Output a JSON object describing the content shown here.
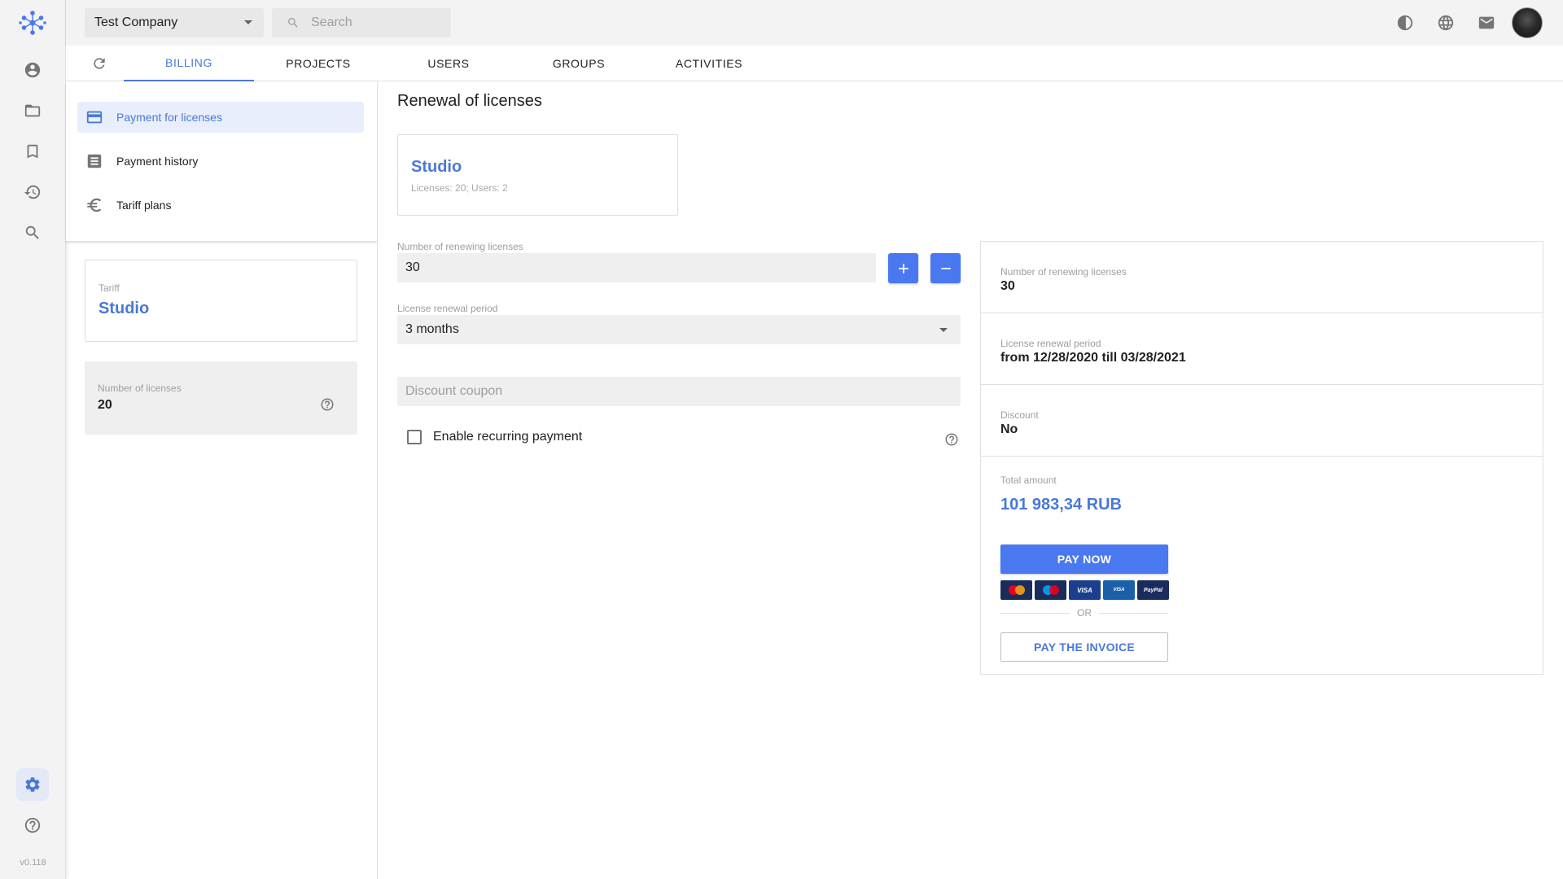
{
  "app": {
    "version": "v0.118"
  },
  "topbar": {
    "company": "Test Company",
    "search_placeholder": "Search"
  },
  "tabs": [
    {
      "label": "BILLING",
      "active": true
    },
    {
      "label": "PROJECTS",
      "active": false
    },
    {
      "label": "USERS",
      "active": false
    },
    {
      "label": "GROUPS",
      "active": false
    },
    {
      "label": "ACTIVITIES",
      "active": false
    }
  ],
  "menu": {
    "items": [
      {
        "label": "Payment for licenses",
        "icon": "credit-card-icon",
        "active": true
      },
      {
        "label": "Payment history",
        "icon": "receipt-list-icon",
        "active": false
      },
      {
        "label": "Tariff plans",
        "icon": "euro-icon",
        "active": false
      }
    ]
  },
  "tariff": {
    "label": "Tariff",
    "name": "Studio"
  },
  "licenses": {
    "label": "Number of licenses",
    "value": "20"
  },
  "main": {
    "title": "Renewal of licenses",
    "plan": {
      "name": "Studio",
      "meta": "Licenses: 20; Users: 2"
    },
    "renewing_label": "Number of renewing licenses",
    "renewing_value": "30",
    "period_label": "License renewal period",
    "period_value": "3 months",
    "coupon_placeholder": "Discount coupon",
    "recurring_label": "Enable recurring payment"
  },
  "summary": {
    "renewing_label": "Number of renewing licenses",
    "renewing_value": "30",
    "period_label": "License renewal period",
    "period_value": "from 12/28/2020 till 03/28/2021",
    "discount_label": "Discount",
    "discount_value": "No",
    "total_label": "Total amount",
    "total_value": "101 983,34 RUB",
    "pay_now": "PAY NOW",
    "or": "OR",
    "pay_invoice": "PAY THE INVOICE",
    "cards": [
      {
        "name": "MasterCard",
        "color": "#1a2b5e"
      },
      {
        "name": "Maestro",
        "color": "#1a2b5e"
      },
      {
        "name": "VISA",
        "color": "#1a3f8f"
      },
      {
        "name": "VISA Electron",
        "color": "#1a5fa8"
      },
      {
        "name": "PayPal",
        "color": "#1a2b5e"
      }
    ]
  },
  "colors": {
    "accent": "#4a78d6",
    "button": "#4a78f0"
  }
}
